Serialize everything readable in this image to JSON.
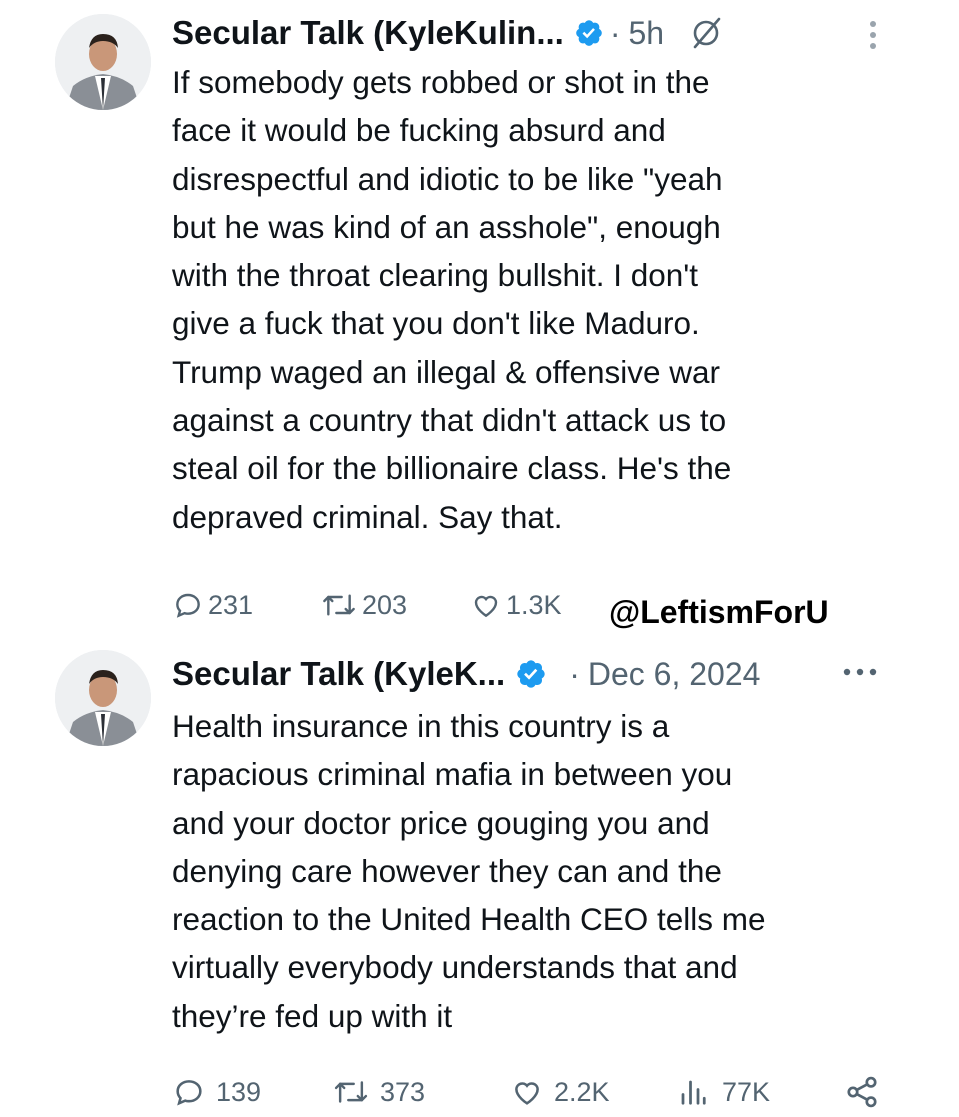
{
  "watermark": "@LeftismForU",
  "colors": {
    "verified": "#1d9bf0",
    "text": "#0f1419",
    "muted": "#536471"
  },
  "tweets": [
    {
      "author": "Secular Talk (KyleKulin...",
      "separator": "·",
      "time": "5h",
      "icons": [
        "avatar",
        "verified-badge-icon",
        "grok-icon",
        "kebab-menu-icon"
      ],
      "lines": [
        "If somebody gets robbed or shot in the",
        "face it would be fucking absurd and",
        "disrespectful and idiotic to be like \"yeah",
        "but he was kind of an asshole\", enough",
        "with the throat clearing bullshit. I don't",
        "give a fuck that you don't like Maduro.",
        "Trump waged an illegal & offensive war",
        "against a country that didn't attack us to",
        "steal oil for the billionaire class. He's the",
        "depraved criminal. Say that."
      ],
      "replies": "231",
      "reposts": "203",
      "likes": "1.3K"
    },
    {
      "author": "Secular Talk (KyleK...",
      "separator": "·",
      "time": "Dec 6, 2024",
      "icons": [
        "avatar",
        "verified-badge-icon",
        "more-icon"
      ],
      "lines": [
        "Health insurance in this country is a",
        "rapacious criminal mafia in between you",
        "and your doctor price gouging you and",
        "denying care however they can and the",
        "reaction to the United Health CEO tells me",
        "virtually everybody understands that and",
        "they’re fed up with it"
      ],
      "replies": "139",
      "reposts": "373",
      "likes": "2.2K",
      "views": "77K"
    }
  ]
}
